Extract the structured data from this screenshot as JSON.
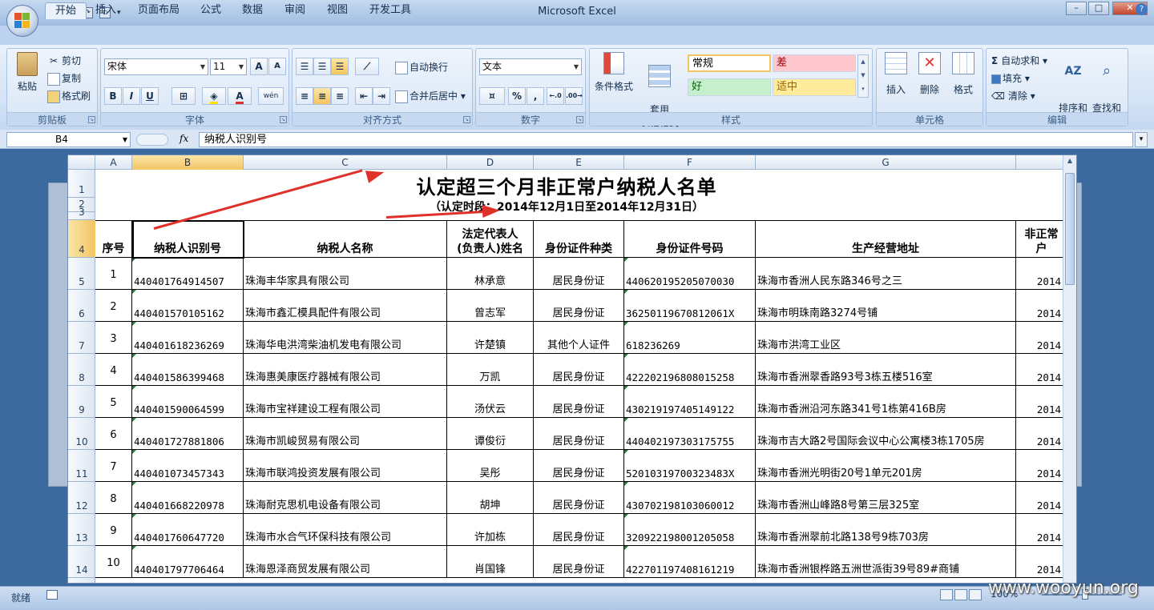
{
  "window": {
    "title": "Microsoft Excel"
  },
  "tabs": [
    "开始",
    "插入",
    "页面布局",
    "公式",
    "数据",
    "审阅",
    "视图",
    "开发工具"
  ],
  "ribbon": {
    "clipboard": {
      "label": "剪贴板",
      "paste": "粘贴",
      "cut": "剪切",
      "copy": "复制",
      "format_painter": "格式刷"
    },
    "font": {
      "label": "字体",
      "name": "宋体",
      "size": "11",
      "grow": "A",
      "shrink": "A",
      "bold": "B",
      "italic": "I",
      "underline": "U",
      "wen": "wén"
    },
    "alignment": {
      "label": "对齐方式",
      "wrap": "自动换行",
      "merge": "合并后居中"
    },
    "number": {
      "label": "数字",
      "format": "文本",
      "percent": "%",
      "comma": ","
    },
    "styles": {
      "label": "样式",
      "conditional": "条件格式",
      "table_format": "套用\n表格格式",
      "normal": "常规",
      "bad": "差",
      "good": "好",
      "neutral": "适中"
    },
    "cells": {
      "label": "单元格",
      "insert": "插入",
      "delete": "删除",
      "format": "格式"
    },
    "editing": {
      "label": "编辑",
      "autosum": "自动求和",
      "fill": "填充",
      "clear": "清除",
      "sort_filter": "排序和\n筛选",
      "find_select": "查找和\n选择"
    }
  },
  "formula_bar": {
    "name_box": "B4",
    "fx": "fx",
    "content": "纳税人识别号"
  },
  "columns": [
    "A",
    "B",
    "C",
    "D",
    "E",
    "F",
    "G"
  ],
  "sheet": {
    "title": "认定超三个月非正常户纳税人名单",
    "subtitle": "（认定时段：2014年12月1日至2014年12月31日）",
    "headers": {
      "seq": "序号",
      "tax_id": "纳税人识别号",
      "name": "纳税人名称",
      "legal_rep": "法定代表人\n(负责人)姓名",
      "id_type": "身份证件种类",
      "id_number": "身份证件号码",
      "address": "生产经营地址",
      "extra": "非正常户"
    },
    "row_numbers": [
      "1",
      "2",
      "3",
      "4",
      "5",
      "6",
      "7",
      "8",
      "9",
      "10",
      "11",
      "12",
      "13",
      "14"
    ],
    "rows": [
      {
        "seq": "1",
        "tax_id": "440401764914507",
        "name": "珠海丰华家具有限公司",
        "rep": "林承意",
        "id_type": "居民身份证",
        "id_no": "440620195205070030",
        "addr": "珠海市香洲人民东路346号之三",
        "extra": "2014"
      },
      {
        "seq": "2",
        "tax_id": "440401570105162",
        "name": "珠海市鑫汇模具配件有限公司",
        "rep": "曾志军",
        "id_type": "居民身份证",
        "id_no": "36250119670812061X",
        "addr": "珠海市明珠南路3274号铺",
        "extra": "2014"
      },
      {
        "seq": "3",
        "tax_id": "440401618236269",
        "name": "珠海华电洪湾柴油机发电有限公司",
        "rep": "许楚镇",
        "id_type": "其他个人证件",
        "id_no": "618236269",
        "addr": "珠海市洪湾工业区",
        "extra": "2014"
      },
      {
        "seq": "4",
        "tax_id": "440401586399468",
        "name": "珠海惠美康医疗器械有限公司",
        "rep": "万凯",
        "id_type": "居民身份证",
        "id_no": "422202196808015258",
        "addr": "珠海市香洲翠香路93号3栋五楼516室",
        "extra": "2014"
      },
      {
        "seq": "5",
        "tax_id": "440401590064599",
        "name": "珠海市宝祥建设工程有限公司",
        "rep": "汤伏云",
        "id_type": "居民身份证",
        "id_no": "430219197405149122",
        "addr": "珠海市香洲沿河东路341号1栋第416B房",
        "extra": "2014"
      },
      {
        "seq": "6",
        "tax_id": "440401727881806",
        "name": "珠海市凯峻贸易有限公司",
        "rep": "谭俊衍",
        "id_type": "居民身份证",
        "id_no": "440402197303175755",
        "addr": "珠海市吉大路2号国际会议中心公寓楼3栋1705房",
        "extra": "2014"
      },
      {
        "seq": "7",
        "tax_id": "440401073457343",
        "name": "珠海市联鸿投资发展有限公司",
        "rep": "吴彤",
        "id_type": "居民身份证",
        "id_no": "52010319700323483X",
        "addr": "珠海市香洲光明街20号1单元201房",
        "extra": "2014"
      },
      {
        "seq": "8",
        "tax_id": "440401668220978",
        "name": "珠海耐克思机电设备有限公司",
        "rep": "胡坤",
        "id_type": "居民身份证",
        "id_no": "430702198103060012",
        "addr": "珠海市香洲山峰路8号第三层325室",
        "extra": "2014"
      },
      {
        "seq": "9",
        "tax_id": "440401760647720",
        "name": "珠海市水合气环保科技有限公司",
        "rep": "许加栋",
        "id_type": "居民身份证",
        "id_no": "320922198001205058",
        "addr": "珠海市香洲翠前北路138号9栋703房",
        "extra": "2014"
      },
      {
        "seq": "10",
        "tax_id": "440401797706464",
        "name": "珠海恩泽商贸发展有限公司",
        "rep": "肖国锋",
        "id_type": "居民身份证",
        "id_no": "422701197408161219",
        "addr": "珠海市香洲银桦路五洲世派街39号89#商铺",
        "extra": "2014"
      }
    ]
  },
  "status": {
    "ready": "就绪",
    "zoom": "100%"
  },
  "watermark": "www.wooyun.org"
}
